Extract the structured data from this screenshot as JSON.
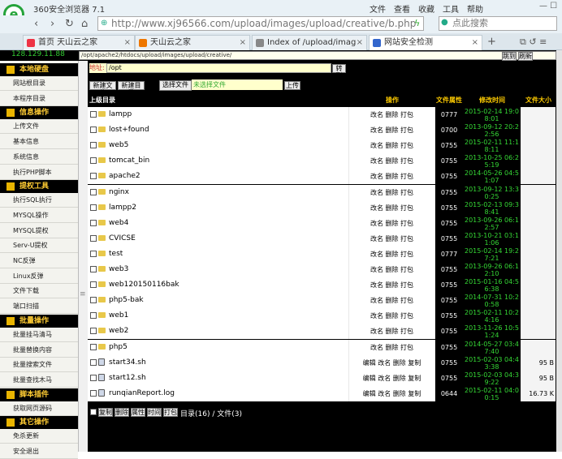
{
  "browser": {
    "title": "360安全浏览器 7.1",
    "menu": [
      "文件",
      "查看",
      "收藏",
      "工具",
      "帮助"
    ],
    "url": "http://www.xj96566.com/upload/images/upload/creative/b.php",
    "search_placeholder": "点此搜索",
    "tabs": [
      {
        "label": "首页 天山云之家",
        "color": "#e34"
      },
      {
        "label": "天山云之家",
        "color": "#e70"
      },
      {
        "label": "Index of /upload/imag",
        "color": "#888"
      },
      {
        "label": "网站安全检测",
        "color": "#36c"
      }
    ]
  },
  "shell": {
    "ip": "128.129.11.88",
    "path": "/opt/apache2/htdocs/upload/images/upload/creative/",
    "jump_label": "跳到",
    "refresh_label": "刷新",
    "addr_label": "地址:",
    "addr_value": "/opt",
    "goto_label": "转到",
    "new_file_label": "新建文件",
    "new_dir_label": "新建目录",
    "choose_file_label": "选择文件",
    "no_file_label": "未选择文件",
    "upload_label": "上传"
  },
  "sidebar": {
    "sections": [
      {
        "title": "本地硬盘",
        "items": [
          "网站根目录",
          "本程序目录"
        ]
      },
      {
        "title": "信息操作",
        "items": [
          "上传文件",
          "基本信息",
          "系统信息",
          "执行PHP脚本"
        ]
      },
      {
        "title": "提权工具",
        "items": [
          "执行SQL执行",
          "MYSQL操作",
          "MYSQL提权",
          "Serv-U提权",
          "NC反弹",
          "Linux反弹",
          "文件下载",
          "端口扫描"
        ]
      },
      {
        "title": "批量操作",
        "items": [
          "批量挂马清马",
          "批量替换内容",
          "批量搜索文件",
          "批量查找木马"
        ]
      },
      {
        "title": "脚本插件",
        "items": [
          "获取网页源码"
        ]
      },
      {
        "title": "其它操作",
        "items": [
          "免杀更新",
          "安全退出"
        ]
      }
    ]
  },
  "table": {
    "headers": [
      "上级目录",
      "操作",
      "文件属性",
      "修改时间",
      "文件大小"
    ],
    "rows": [
      {
        "name": "lampp",
        "type": "dir",
        "op": "改名 删除 打包",
        "perm": "0777",
        "time": "2015-02-14 19:08:01",
        "size": ""
      },
      {
        "name": "lost+found",
        "type": "dir",
        "op": "改名 删除 打包",
        "perm": "0700",
        "time": "2013-09-12 20:22:56",
        "size": ""
      },
      {
        "name": "web5",
        "type": "dir",
        "op": "改名 删除 打包",
        "perm": "0755",
        "time": "2015-02-11 11:18:11",
        "size": ""
      },
      {
        "name": "tomcat_bin",
        "type": "dir",
        "op": "改名 删除 打包",
        "perm": "0755",
        "time": "2013-10-25 06:25:19",
        "size": ""
      },
      {
        "name": "apache2",
        "type": "dir",
        "op": "改名 删除 打包",
        "perm": "0755",
        "time": "2014-05-26 04:51:07",
        "size": ""
      },
      {
        "name": "nginx",
        "type": "dir",
        "op": "改名 删除 打包",
        "perm": "0755",
        "time": "2013-09-12 13:30:25",
        "size": ""
      },
      {
        "name": "lampp2",
        "type": "dir",
        "op": "改名 删除 打包",
        "perm": "0755",
        "time": "2015-02-13 09:38:41",
        "size": ""
      },
      {
        "name": "web4",
        "type": "dir",
        "op": "改名 删除 打包",
        "perm": "0755",
        "time": "2013-09-26 06:12:57",
        "size": ""
      },
      {
        "name": "CVICSE",
        "type": "dir",
        "op": "改名 删除 打包",
        "perm": "0755",
        "time": "2013-10-21 03:11:06",
        "size": ""
      },
      {
        "name": "test",
        "type": "dir",
        "op": "改名 删除 打包",
        "perm": "0777",
        "time": "2015-02-14 19:27:21",
        "size": ""
      },
      {
        "name": "web3",
        "type": "dir",
        "op": "改名 删除 打包",
        "perm": "0755",
        "time": "2013-09-26 06:12:10",
        "size": ""
      },
      {
        "name": "web120150116bak",
        "type": "dir",
        "op": "改名 删除 打包",
        "perm": "0755",
        "time": "2015-01-16 04:56:38",
        "size": ""
      },
      {
        "name": "php5-bak",
        "type": "dir",
        "op": "改名 删除 打包",
        "perm": "0755",
        "time": "2014-07-31 10:20:58",
        "size": ""
      },
      {
        "name": "web1",
        "type": "dir",
        "op": "改名 删除 打包",
        "perm": "0755",
        "time": "2015-02-11 10:24:16",
        "size": ""
      },
      {
        "name": "web2",
        "type": "dir",
        "op": "改名 删除 打包",
        "perm": "0755",
        "time": "2013-11-26 10:51:24",
        "size": ""
      },
      {
        "name": "php5",
        "type": "dir",
        "op": "改名 删除 打包",
        "perm": "0755",
        "time": "2014-05-27 03:47:40",
        "size": ""
      },
      {
        "name": "start34.sh",
        "type": "file",
        "op": "编辑 改名 删除 复制",
        "perm": "0755",
        "time": "2015-02-03 04:43:38",
        "size": "95 B"
      },
      {
        "name": "start12.sh",
        "type": "file",
        "op": "编辑 改名 删除 复制",
        "perm": "0755",
        "time": "2015-02-03 04:39:22",
        "size": "95 B"
      },
      {
        "name": "runqianReport.log",
        "type": "file",
        "op": "编辑 改名 删除 复制",
        "perm": "0644",
        "time": "2015-02-11 04:00:15",
        "size": "16.73 K"
      }
    ]
  },
  "footer": {
    "buttons": [
      "复制",
      "删除",
      "属性",
      "时间",
      "打包"
    ],
    "summary": "目录(16) / 文件(3)"
  },
  "colors": {
    "accent_green": "#35d835",
    "header_yellow": "#ffcc00",
    "section_icon": "#e9b400"
  }
}
